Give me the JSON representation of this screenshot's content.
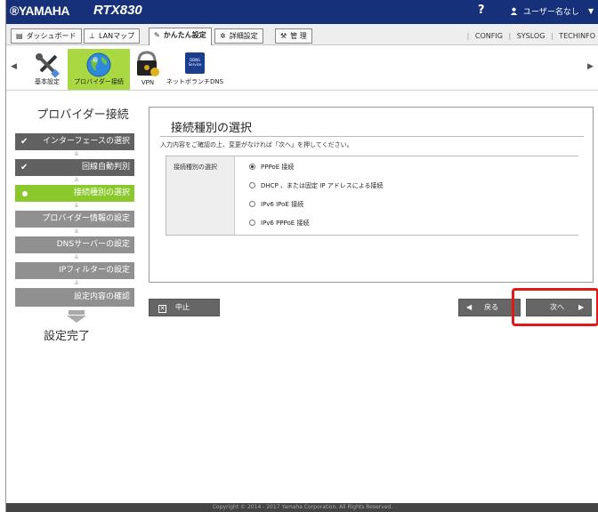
{
  "header": {
    "brand": "®YAMAHA",
    "model": "RTX830",
    "help": "?",
    "user": "ユーザー名なし"
  },
  "menu": {
    "items": [
      {
        "icon": "dashboard-icon",
        "label": "ダッシュボード"
      },
      {
        "icon": "lan-map-icon",
        "label": "LANマップ"
      },
      {
        "icon": "wizard-icon",
        "label": "かんたん設定"
      },
      {
        "icon": "gear-icon",
        "label": "詳細設定"
      },
      {
        "icon": "wrench-icon",
        "label": "管 理"
      }
    ],
    "system_links": [
      "CONFIG",
      "SYSLOG",
      "TECHINFO"
    ]
  },
  "tools": [
    {
      "icon": "wrench-screwdriver-icon",
      "label": "基本設定"
    },
    {
      "icon": "globe-icon",
      "label": "プロバイダー接続"
    },
    {
      "icon": "vpn-lock-icon",
      "label": "VPN"
    },
    {
      "icon": "dns-service-icon",
      "label": "ネットボランチDNS",
      "icon_text": "DDNS Service"
    }
  ],
  "sidebar": {
    "title": "プロバイダー接続",
    "steps": [
      {
        "label": "インターフェースの選択",
        "state": "done"
      },
      {
        "label": "回線自動判別",
        "state": "done"
      },
      {
        "label": "接続種別の選択",
        "state": "current"
      },
      {
        "label": "プロバイダー情報の設定",
        "state": "pending"
      },
      {
        "label": "DNSサーバーの設定",
        "state": "pending"
      },
      {
        "label": "IPフィルターの設定",
        "state": "pending"
      },
      {
        "label": "設定内容の確認",
        "state": "pending"
      }
    ],
    "finish": "設定完了"
  },
  "main": {
    "title": "接続種別の選択",
    "description": "入力内容をご確認の上、変更がなければ「次へ」を押してください。",
    "field_label": "接続種別の選択",
    "options": [
      {
        "label": "PPPoE 接続",
        "selected": true
      },
      {
        "label": "DHCP 、または固定 IP アドレスによる接続",
        "selected": false
      },
      {
        "label": "IPv6 IPoE 接続",
        "selected": false
      },
      {
        "label": "IPv6 PPPoE 接続",
        "selected": false
      }
    ]
  },
  "actions": {
    "cancel": "中止",
    "back": "戻る",
    "next": "次へ"
  },
  "footer": "Copyright © 2014 - 2017 Yamaha Corporation. All Rights Reserved.",
  "colors": {
    "header_bg": "#16307a",
    "accent_green": "#8ac82b",
    "highlight_red": "#e01919"
  }
}
